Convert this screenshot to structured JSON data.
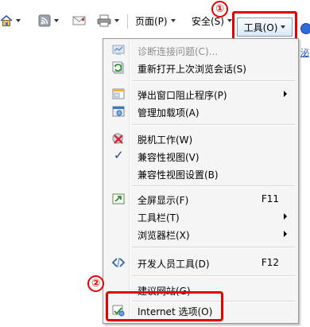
{
  "toolbar": {
    "page_label": "页面(P)",
    "safety_label": "安全(S)",
    "tools_label": "工具(O)",
    "step1_marker": "①"
  },
  "menu": {
    "items": [
      {
        "label": "诊断连接问题(C)...",
        "icon": "diagnose-icon",
        "disabled": true
      },
      {
        "label": "重新打开上次浏览会话(S)",
        "icon": "reopen-session-icon"
      },
      {
        "label": "弹出窗口阻止程序(P)",
        "icon": "popup-blocker-icon",
        "submenu": true
      },
      {
        "label": "管理加载项(A)",
        "icon": "addons-icon"
      },
      {
        "label": "脱机工作(W)",
        "icon": "work-offline-icon"
      },
      {
        "label": "兼容性视图(V)",
        "icon": "checkmark-icon",
        "checked": true
      },
      {
        "label": "兼容性视图设置(B)"
      },
      {
        "label": "全屏显示(F)",
        "icon": "fullscreen-icon",
        "shortcut": "F11"
      },
      {
        "label": "工具栏(T)",
        "submenu": true
      },
      {
        "label": "浏览器栏(X)",
        "submenu": true
      },
      {
        "label": "开发人员工具(D)",
        "icon": "developer-tools-icon",
        "shortcut": "F12"
      },
      {
        "label": "建议网站(G)"
      },
      {
        "label": "Internet 选项(O)",
        "icon": "internet-options-icon"
      }
    ],
    "step2_marker": "②"
  },
  "colors": {
    "highlight_red": "#e60000",
    "menu_background": "#f5f5f5",
    "disabled_text": "#8d8d8d"
  }
}
